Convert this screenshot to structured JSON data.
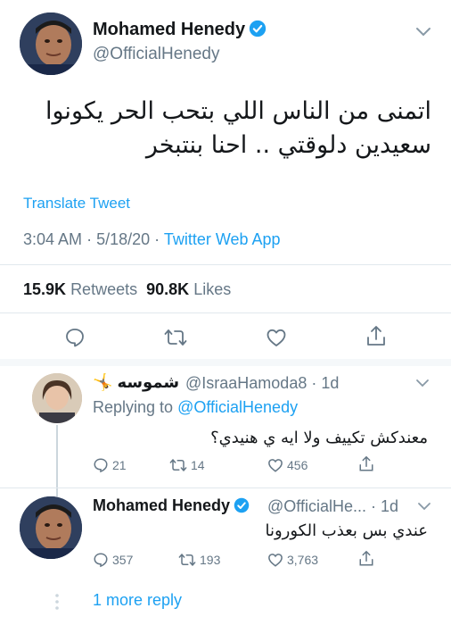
{
  "main_tweet": {
    "author_name": "Mohamed Henedy",
    "handle": "@OfficialHenedy",
    "text_line1": "اتمنى من الناس اللي بتحب الحر يكونوا",
    "text_line2": "سعيدين دلوقتي .. احنا بنتبخر",
    "translate_label": "Translate Tweet",
    "time": "3:04 AM",
    "date": "5/18/20",
    "source_app": "Twitter Web App",
    "retweets_count": "15.9K",
    "retweets_label": "Retweets",
    "likes_count": "90.8K",
    "likes_label": "Likes"
  },
  "replies": [
    {
      "author_name": "شموسه",
      "author_emoji": "🤸",
      "handle": "@IsraaHamoda8",
      "time_ago": "1d",
      "replying_to_label": "Replying to",
      "replying_to_handle": "@OfficialHenedy",
      "text": "معندكش تكييف ولا ايه ي هنيدي؟",
      "reply_count": "21",
      "retweet_count": "14",
      "like_count": "456"
    },
    {
      "author_name": "Mohamed Henedy",
      "handle": "@OfficialHe...",
      "time_ago": "1d",
      "text": "عندي بس بعذب الكورونا",
      "reply_count": "357",
      "retweet_count": "193",
      "like_count": "3,763"
    }
  ],
  "more_replies_label": "1 more reply",
  "colors": {
    "accent": "#1da1f2",
    "muted": "#657786",
    "text": "#14171a",
    "divider": "#e1e8ed"
  },
  "icons": [
    "verified-badge-icon",
    "chevron-down-icon",
    "reply-icon",
    "retweet-icon",
    "like-icon",
    "share-icon"
  ]
}
